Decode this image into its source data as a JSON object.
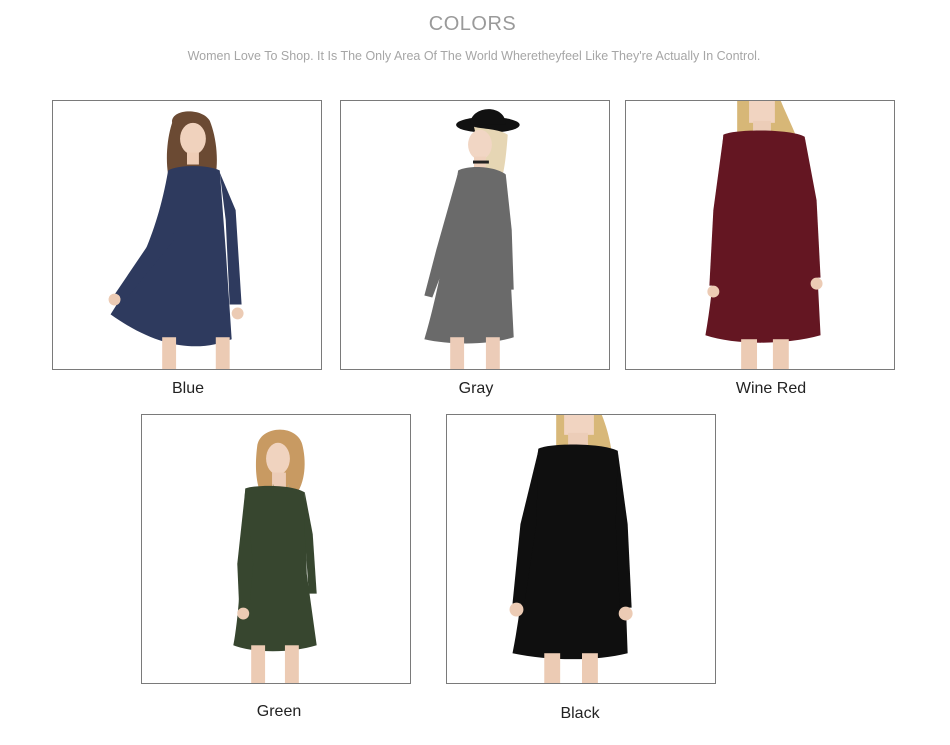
{
  "header": {
    "title": "COLORS",
    "subtitle": "Women Love To Shop. It Is The Only Area Of The World Wheretheyfeel Like They're Actually In Control."
  },
  "colors": [
    {
      "label": "Blue",
      "dress": "#2e3a5e",
      "hair": "#6b4a33"
    },
    {
      "label": "Gray",
      "dress": "#6a6a6a",
      "hair": "#e6d6b4"
    },
    {
      "label": "Wine Red",
      "dress": "#641622",
      "hair": "#d7b777"
    },
    {
      "label": "Green",
      "dress": "#37462f",
      "hair": "#c89a62"
    },
    {
      "label": "Black",
      "dress": "#0f0f0f",
      "hair": "#d8b879"
    }
  ]
}
